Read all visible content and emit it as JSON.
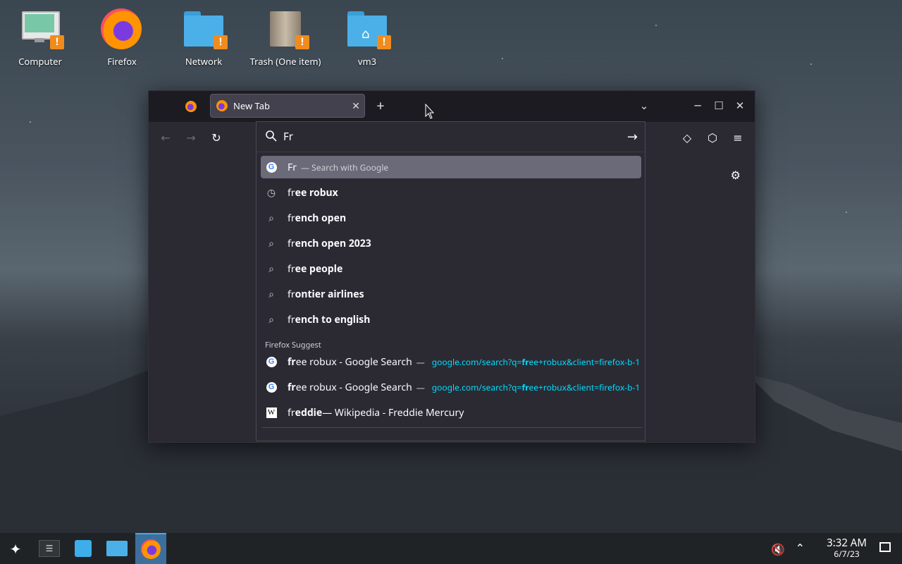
{
  "desktop": {
    "icons": [
      {
        "label": "Computer"
      },
      {
        "label": "Firefox"
      },
      {
        "label": "Network"
      },
      {
        "label": "Trash (One item)"
      },
      {
        "label": "vm3"
      }
    ]
  },
  "browser": {
    "tab_title": "New Tab",
    "url_input_value": "Fr",
    "suggestions": [
      {
        "typed": "Fr",
        "rest": "",
        "sub": "— Search with Google",
        "icon": "google-icon"
      },
      {
        "typed": "fr",
        "rest": "ee robux",
        "icon": "history-icon"
      },
      {
        "typed": "fr",
        "rest": "ench open",
        "icon": "search-icon"
      },
      {
        "typed": "fr",
        "rest": "ench open 2023",
        "icon": "search-icon"
      },
      {
        "typed": "fr",
        "rest": "ee people",
        "icon": "search-icon"
      },
      {
        "typed": "fr",
        "rest": "ontier airlines",
        "icon": "search-icon"
      },
      {
        "typed": "fr",
        "rest": "ench to english",
        "icon": "search-icon"
      }
    ],
    "group_label": "Firefox Suggest",
    "firefox_suggest": [
      {
        "title_bold": "fr",
        "title_rest": "ee robux - Google Search",
        "sep": "—",
        "url_pre": "google.com/search?q=",
        "url_bold": "fr",
        "url_post": "ee+robux&client=firefox-b-1",
        "icon": "google-icon"
      },
      {
        "title_bold": "fr",
        "title_rest": "ee robux - Google Search",
        "sep": "—",
        "url_pre": "google.com/search?q=",
        "url_bold": "fr",
        "url_post": "ee+robux&client=firefox-b-1",
        "icon": "google-icon"
      },
      {
        "title_bold": "fr",
        "title_rest": "eddie",
        "suffix": " — Wikipedia - Freddie Mercury",
        "icon": "wikipedia-icon"
      }
    ]
  },
  "taskbar": {
    "time": "3:32 AM",
    "date": "6/7/23"
  },
  "colors": {
    "taskbar_active": "#3d6f9c",
    "url_link": "#00ddff",
    "warning_badge": "#f08c1e"
  }
}
